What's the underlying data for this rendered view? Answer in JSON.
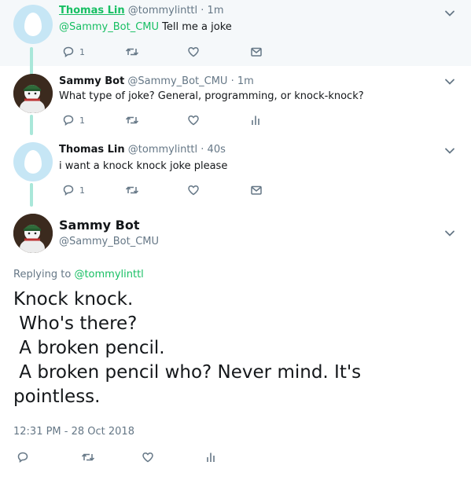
{
  "tweets": [
    {
      "name": "Thomas Lin",
      "handle": "@tommylinttl",
      "time": "1m",
      "mention": "@Sammy_Bot_CMU",
      "text": " Tell me a joke",
      "reply_count": "1"
    },
    {
      "name": "Sammy Bot",
      "handle": "@Sammy_Bot_CMU",
      "time": "1m",
      "text": "What type of joke? General, programming, or knock-knock?",
      "reply_count": "1"
    },
    {
      "name": "Thomas Lin",
      "handle": "@tommylinttl",
      "time": "40s",
      "text": "i want a knock knock joke please",
      "reply_count": "1"
    }
  ],
  "main_tweet": {
    "name": "Sammy Bot",
    "handle": "@Sammy_Bot_CMU",
    "replying_prefix": "Replying to ",
    "replying_to": "@tommylinttl",
    "text": "Knock knock.\n Who's there?\n A broken pencil.\n A broken pencil who? Never mind. It's\npointless.",
    "timestamp": "12:31 PM - 28 Oct 2018"
  },
  "separator": "·"
}
